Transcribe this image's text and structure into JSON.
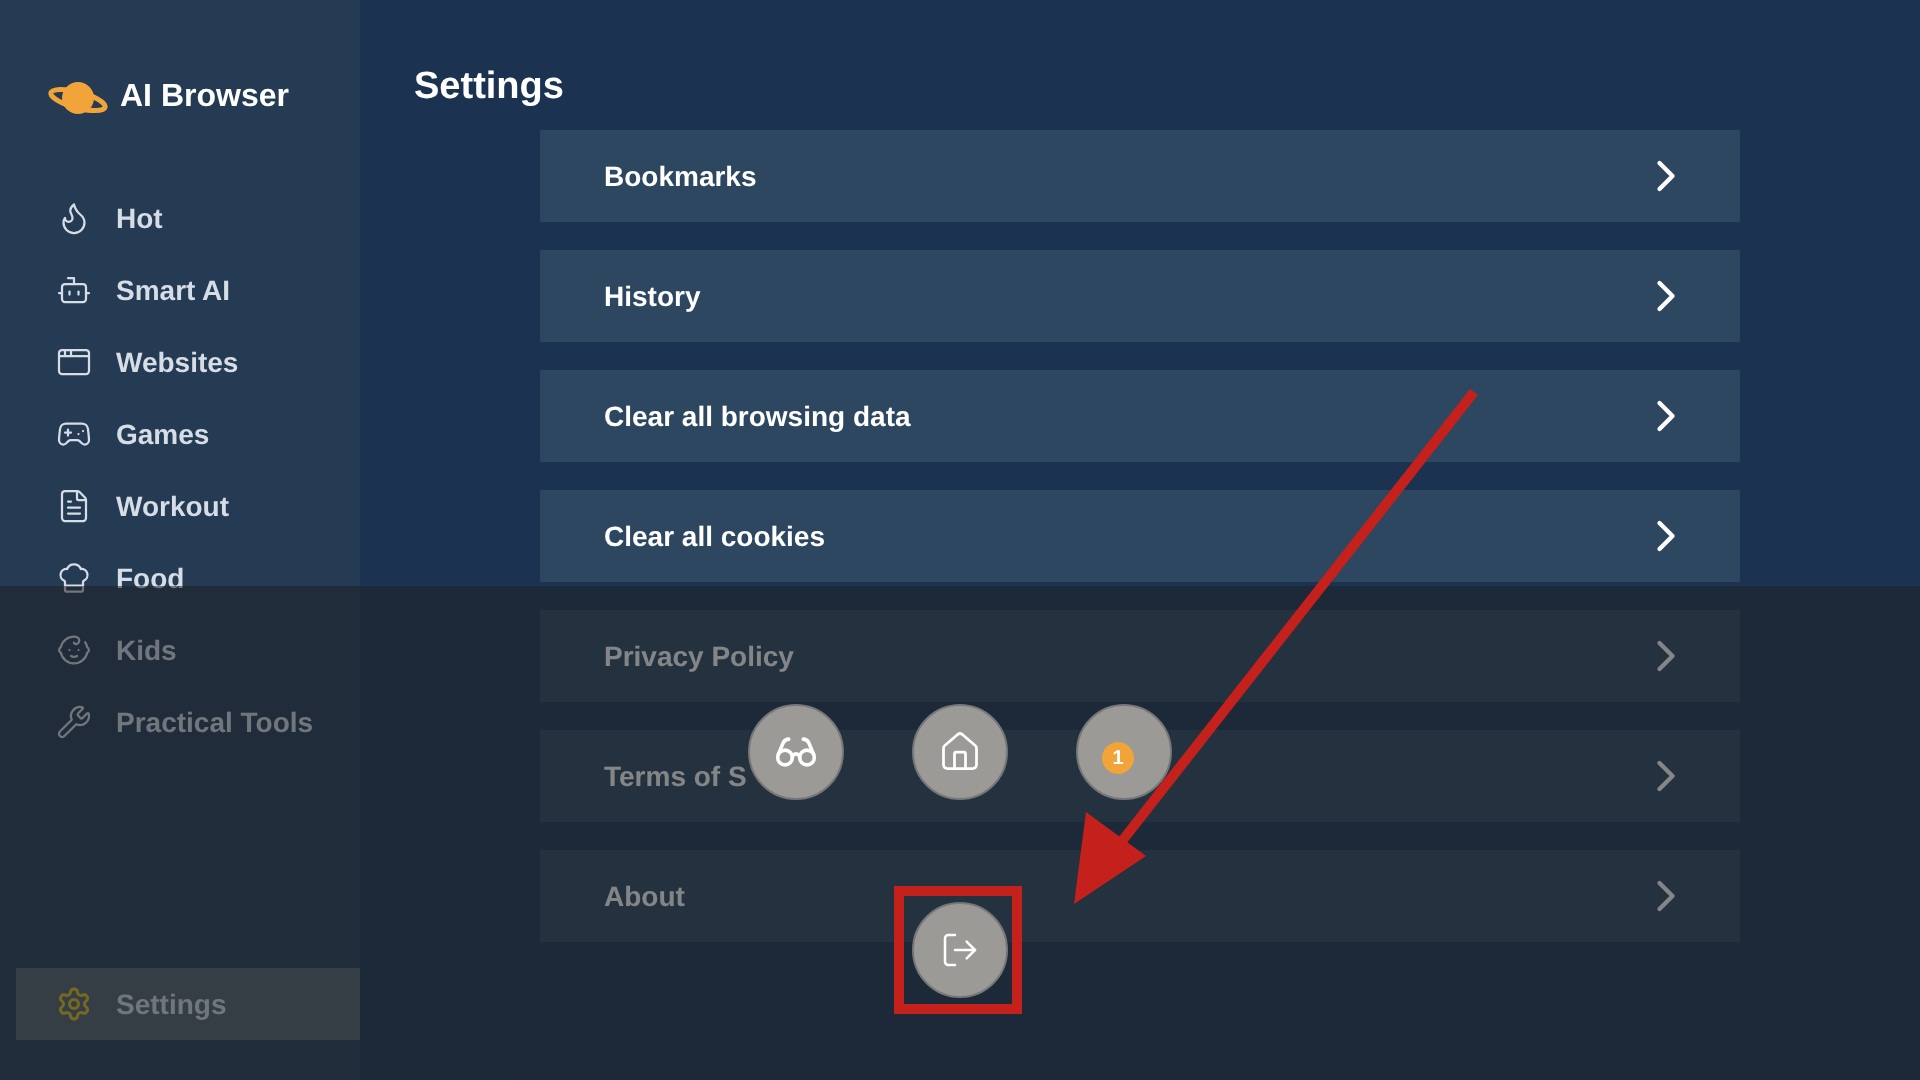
{
  "app": {
    "name": "AI Browser"
  },
  "sidebar": {
    "items": [
      {
        "label": "Hot",
        "selected": false
      },
      {
        "label": "Smart AI",
        "selected": false
      },
      {
        "label": "Websites",
        "selected": false
      },
      {
        "label": "Games",
        "selected": false
      },
      {
        "label": "Workout",
        "selected": false
      },
      {
        "label": "Food",
        "selected": false
      },
      {
        "label": "Kids",
        "selected": false
      },
      {
        "label": "Practical Tools",
        "selected": false
      }
    ],
    "footer_item": {
      "label": "Settings",
      "selected": true
    }
  },
  "page": {
    "title": "Settings"
  },
  "settings_rows": [
    {
      "label": "Bookmarks"
    },
    {
      "label": "History"
    },
    {
      "label": "Clear all browsing data"
    },
    {
      "label": "Clear all cookies"
    },
    {
      "label": "Privacy Policy"
    },
    {
      "label": "Terms of S"
    },
    {
      "label": "About"
    }
  ],
  "quick_menu": {
    "tabs_badge": "1"
  }
}
